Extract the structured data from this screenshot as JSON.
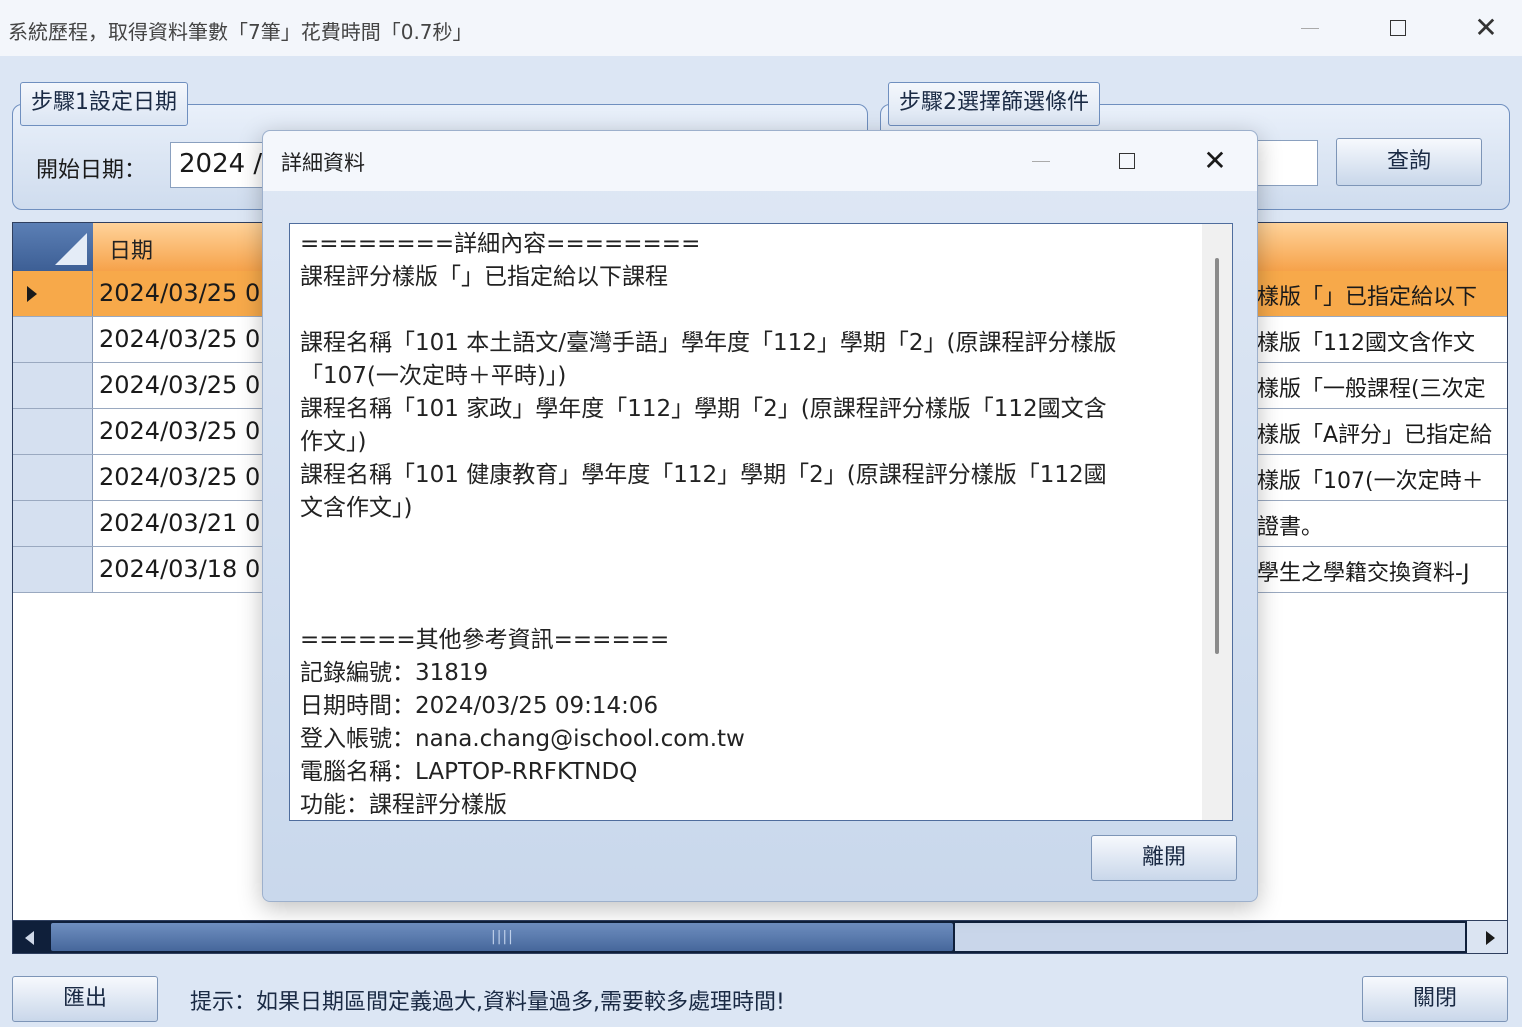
{
  "window": {
    "title": "系統歷程，取得資料筆數「7筆」花費時間「0.7秒」"
  },
  "step1": {
    "legend": "步驟1設定日期",
    "start_label": "開始日期：",
    "start_value": "2024 /"
  },
  "step2": {
    "legend": "步驟2選擇篩選條件",
    "query_button": "查詢"
  },
  "grid": {
    "date_header": "日期",
    "rows": [
      {
        "date": "2024/03/25 0",
        "desc": "樣版「」已指定給以下"
      },
      {
        "date": "2024/03/25 0",
        "desc": "樣版「112國文含作文"
      },
      {
        "date": "2024/03/25 0",
        "desc": "樣版「一般課程(三次定"
      },
      {
        "date": "2024/03/25 0",
        "desc": "樣版「A評分」已指定給"
      },
      {
        "date": "2024/03/25 0",
        "desc": "樣版「107(一次定時＋"
      },
      {
        "date": "2024/03/21 0",
        "desc": "證書。"
      },
      {
        "date": "2024/03/18 0",
        "desc": "學生之學籍交換資料-J"
      }
    ],
    "scroll_grip": "||||"
  },
  "footer": {
    "export_button": "匯出",
    "hint": "提示：如果日期區間定義過大,資料量過多,需要較多處理時間!",
    "close_button": "關閉"
  },
  "dialog": {
    "title": "詳細資料",
    "lines": [
      "========詳細內容========",
      "課程評分樣版「」已指定給以下課程",
      "",
      "課程名稱「101 本土語文/臺灣手語」學年度「112」學期「2」(原課程評分樣版",
      "「107(一次定時＋平時)」)",
      "課程名稱「101 家政」學年度「112」學期「2」(原課程評分樣版「112國文含",
      "作文」)",
      "課程名稱「101 健康教育」學年度「112」學期「2」(原課程評分樣版「112國",
      "文含作文」)",
      "",
      "",
      "",
      "======其他參考資訊======",
      "記錄編號：31819",
      "日期時間：2024/03/25 09:14:06",
      "登入帳號：nana.chang@ischool.com.tw",
      "電腦名稱：LAPTOP-RRFKTNDQ",
      "功能：課程評分樣版"
    ],
    "leave_button": "離開"
  }
}
